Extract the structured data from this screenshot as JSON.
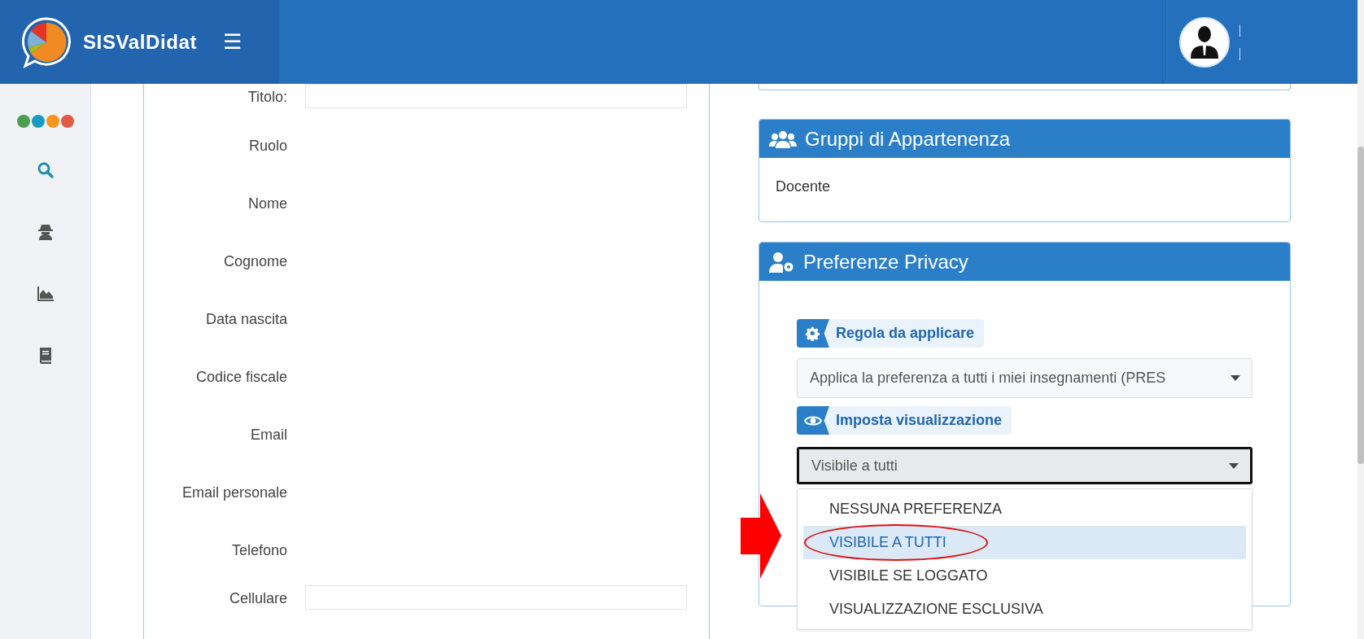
{
  "header": {
    "brand": "SISValDidat",
    "menu_toggle": "☰"
  },
  "sidebar": {
    "dots": [
      {
        "color": "#4c9e4f"
      },
      {
        "color": "#1a9bc1"
      },
      {
        "color": "#f7941d"
      },
      {
        "color": "#e05a45"
      }
    ],
    "items": [
      {
        "kind": "search",
        "selected": true
      },
      {
        "kind": "spy",
        "selected": false
      },
      {
        "kind": "chart",
        "selected": false
      },
      {
        "kind": "book",
        "selected": false
      }
    ]
  },
  "profile_form": {
    "fields": [
      {
        "label": "Titolo:",
        "kind": "input"
      },
      {
        "label": "Ruolo",
        "kind": "text"
      },
      {
        "label": "Nome",
        "kind": "text"
      },
      {
        "label": "Cognome",
        "kind": "text"
      },
      {
        "label": "Data nascita",
        "kind": "text"
      },
      {
        "label": "Codice fiscale",
        "kind": "text"
      },
      {
        "label": "Email",
        "kind": "text"
      },
      {
        "label": "Email personale",
        "kind": "text"
      },
      {
        "label": "Telefono",
        "kind": "text"
      },
      {
        "label": "Cellulare",
        "kind": "input"
      }
    ]
  },
  "groups_card": {
    "title": "Gruppi di Appartenenza",
    "items": [
      "Docente"
    ]
  },
  "privacy_card": {
    "title": "Preferenze Privacy",
    "rule_label": "Regola da applicare",
    "rule_value": "Applica la preferenza a tutti i miei insegnamenti (PRES",
    "display_label": "Imposta visualizzazione",
    "display_value": "Visibile a tutti",
    "expanded": true,
    "options": [
      {
        "label": "NESSUNA PREFERENZA",
        "selected": false,
        "circled": false
      },
      {
        "label": "VISIBILE A TUTTI",
        "selected": true,
        "circled": true
      },
      {
        "label": "VISIBILE SE LOGGATO",
        "selected": false,
        "circled": false
      },
      {
        "label": "VISUALIZZAZIONE ESCLUSIVA",
        "selected": false,
        "circled": false
      }
    ]
  }
}
